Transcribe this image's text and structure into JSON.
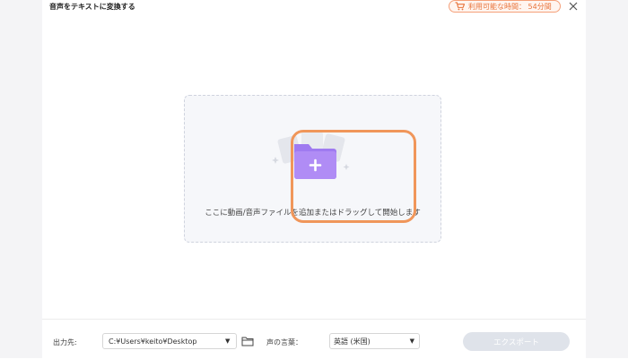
{
  "app": {
    "title": "音声をテキストに変換する",
    "time_badge": {
      "label": "利用可能な時間： 54分間",
      "icon": "shopping-cart-icon",
      "color": "#e8743b"
    },
    "close_icon": "close-icon"
  },
  "dropzone": {
    "icon": "folder-add-icon",
    "instruction": "ここに動画/音声ファイルを追加またはドラッグして開始します"
  },
  "bottombar": {
    "output_label": "出力先:",
    "output_path": "C:¥Users¥keito¥Desktop",
    "language_label": "声の言葉：",
    "language_value": "英語 (米国)",
    "export_label": "エクスポート"
  },
  "colors": {
    "accent": "#a77bf2",
    "highlight": "#f0965a",
    "export_disabled": "#dfe3ea"
  }
}
